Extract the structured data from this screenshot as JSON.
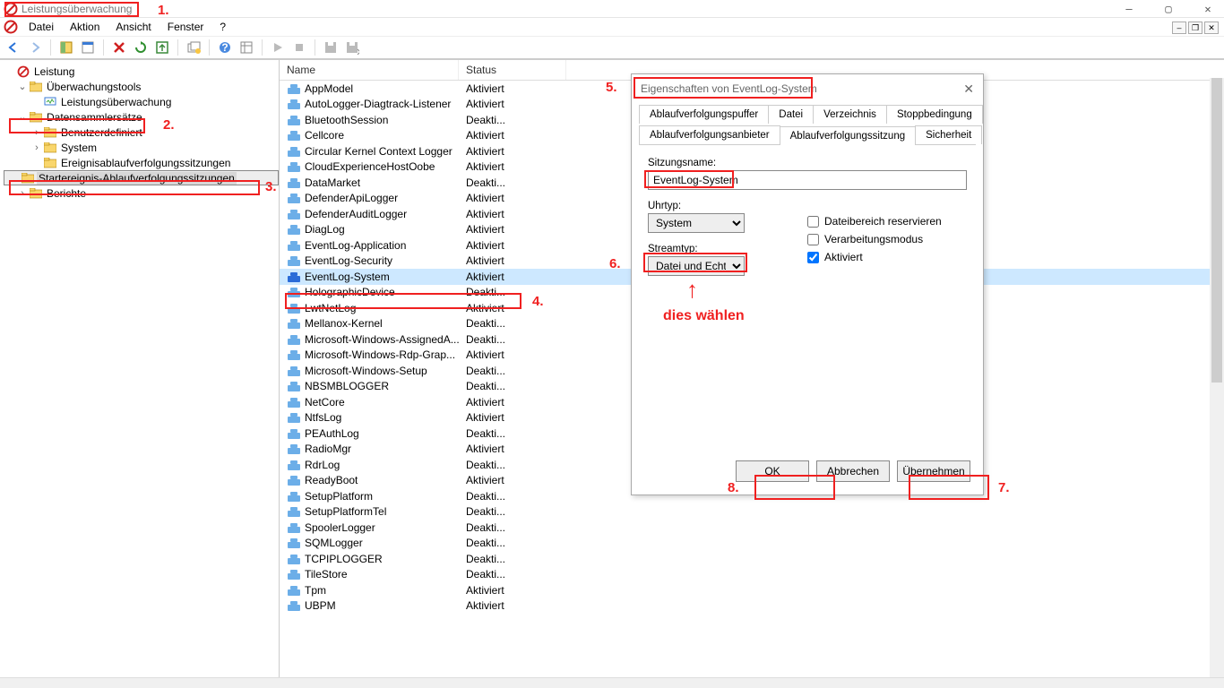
{
  "window": {
    "title": "Leistungsüberwachung"
  },
  "winbtns": {
    "min": "—",
    "max": "▢",
    "close": "✕"
  },
  "menus": [
    "Datei",
    "Aktion",
    "Ansicht",
    "Fenster",
    "?"
  ],
  "tree": {
    "root": "Leistung",
    "items": [
      {
        "label": "Überwachungstools",
        "indent": 1,
        "twist": "v",
        "icon": "folder"
      },
      {
        "label": "Leistungsüberwachung",
        "indent": 2,
        "twist": "",
        "icon": "monitor"
      },
      {
        "label": "Datensammlersätze",
        "indent": 1,
        "twist": "v",
        "icon": "folder"
      },
      {
        "label": "Benutzerdefiniert",
        "indent": 2,
        "twist": ">",
        "icon": "folder"
      },
      {
        "label": "System",
        "indent": 2,
        "twist": ">",
        "icon": "folder"
      },
      {
        "label": "Ereignisablaufverfolgungssitzungen",
        "indent": 2,
        "twist": "",
        "icon": "folder"
      },
      {
        "label": "Startereignis-Ablaufverfolgungssitzungen",
        "indent": 2,
        "twist": "",
        "icon": "folder",
        "selected": true
      },
      {
        "label": "Berichte",
        "indent": 1,
        "twist": ">",
        "icon": "folder"
      }
    ]
  },
  "columns": {
    "name": "Name",
    "status": "Status"
  },
  "rows": [
    {
      "name": "AppModel",
      "status": "Aktiviert"
    },
    {
      "name": "AutoLogger-Diagtrack-Listener",
      "status": "Aktiviert"
    },
    {
      "name": "BluetoothSession",
      "status": "Deakti..."
    },
    {
      "name": "Cellcore",
      "status": "Aktiviert"
    },
    {
      "name": "Circular Kernel Context Logger",
      "status": "Aktiviert"
    },
    {
      "name": "CloudExperienceHostOobe",
      "status": "Aktiviert"
    },
    {
      "name": "DataMarket",
      "status": "Deakti..."
    },
    {
      "name": "DefenderApiLogger",
      "status": "Aktiviert"
    },
    {
      "name": "DefenderAuditLogger",
      "status": "Aktiviert"
    },
    {
      "name": "DiagLog",
      "status": "Aktiviert"
    },
    {
      "name": "EventLog-Application",
      "status": "Aktiviert"
    },
    {
      "name": "EventLog-Security",
      "status": "Aktiviert"
    },
    {
      "name": "EventLog-System",
      "status": "Aktiviert",
      "selected": true
    },
    {
      "name": "HolographicDevice",
      "status": "Deakti..."
    },
    {
      "name": "LwtNetLog",
      "status": "Aktiviert"
    },
    {
      "name": "Mellanox-Kernel",
      "status": "Deakti..."
    },
    {
      "name": "Microsoft-Windows-AssignedA...",
      "status": "Deakti..."
    },
    {
      "name": "Microsoft-Windows-Rdp-Grap...",
      "status": "Aktiviert"
    },
    {
      "name": "Microsoft-Windows-Setup",
      "status": "Deakti..."
    },
    {
      "name": "NBSMBLOGGER",
      "status": "Deakti..."
    },
    {
      "name": "NetCore",
      "status": "Aktiviert"
    },
    {
      "name": "NtfsLog",
      "status": "Aktiviert"
    },
    {
      "name": "PEAuthLog",
      "status": "Deakti..."
    },
    {
      "name": "RadioMgr",
      "status": "Aktiviert"
    },
    {
      "name": "RdrLog",
      "status": "Deakti..."
    },
    {
      "name": "ReadyBoot",
      "status": "Aktiviert"
    },
    {
      "name": "SetupPlatform",
      "status": "Deakti..."
    },
    {
      "name": "SetupPlatformTel",
      "status": "Deakti..."
    },
    {
      "name": "SpoolerLogger",
      "status": "Deakti..."
    },
    {
      "name": "SQMLogger",
      "status": "Deakti..."
    },
    {
      "name": "TCPIPLOGGER",
      "status": "Deakti..."
    },
    {
      "name": "TileStore",
      "status": "Deakti..."
    },
    {
      "name": "Tpm",
      "status": "Aktiviert"
    },
    {
      "name": "UBPM",
      "status": "Aktiviert"
    }
  ],
  "dialog": {
    "title": "Eigenschaften von EventLog-System",
    "tabs_row1": [
      "Ablaufverfolgungspuffer",
      "Datei",
      "Verzeichnis",
      "Stoppbedingung"
    ],
    "tabs_row2": [
      "Ablaufverfolgungsanbieter",
      "Ablaufverfolgungssitzung",
      "Sicherheit"
    ],
    "active_tab": "Ablaufverfolgungssitzung",
    "session_label": "Sitzungsname:",
    "session_value": "EventLog-System",
    "clock_label": "Uhrtyp:",
    "clock_value": "System",
    "stream_label": "Streamtyp:",
    "stream_value": "Datei und Echtze",
    "cb1": "Dateibereich reservieren",
    "cb2": "Verarbeitungsmodus",
    "cb3": "Aktiviert",
    "ok": "OK",
    "cancel": "Abbrechen",
    "apply": "Übernehmen"
  },
  "ann": {
    "n1": "1.",
    "n2": "2.",
    "n3": "3.",
    "n4": "4.",
    "n5": "5.",
    "n6": "6.",
    "n7": "7.",
    "n8": "8.",
    "hint": "dies wählen"
  }
}
